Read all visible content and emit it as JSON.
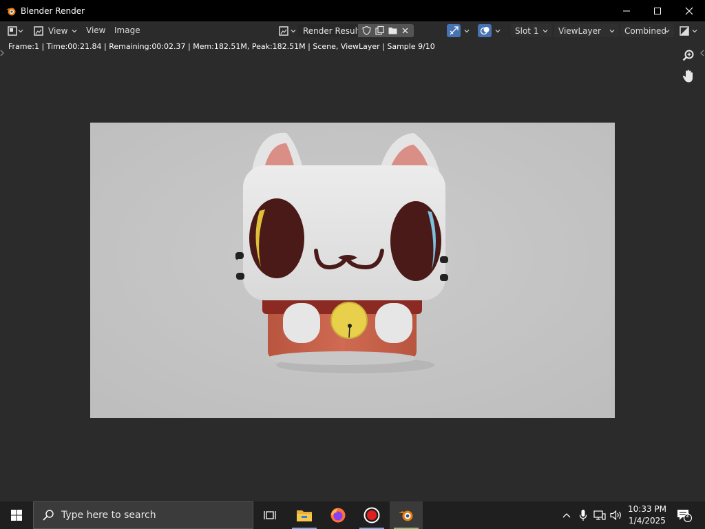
{
  "window": {
    "title": "Blender Render"
  },
  "header": {
    "menus": [
      "View",
      "View",
      "Image"
    ],
    "render_result": "Render Result",
    "slot": "Slot 1",
    "view_layer": "ViewLayer",
    "pass": "Combined"
  },
  "status": {
    "text": "Frame:1 | Time:00:21.84 | Remaining:00:02.37 | Mem:182.51M, Peak:182.51M | Scene, ViewLayer | Sample 9/10"
  },
  "render": {
    "background": "#c6c6c6"
  },
  "taskbar": {
    "search_placeholder": "Type here to search",
    "time": "10:33 PM",
    "date": "1/4/2025",
    "notification_count": "2"
  },
  "colors": {
    "accent": "#4772b3",
    "title_bar": "#000000",
    "editor_bg": "#2b2b2b"
  },
  "icons": [
    "blender-icon",
    "minimize-icon",
    "maximize-icon",
    "close-icon",
    "editor-type-icon",
    "image-icon",
    "shield-icon",
    "copy-icon",
    "folder-icon",
    "x-icon",
    "overlay-icon",
    "gizmo-icon",
    "display-channels-icon",
    "zoom-icon",
    "hand-icon",
    "windows-start-icon",
    "search-icon",
    "task-view-icon",
    "file-explorer-icon",
    "firefox-icon",
    "record-icon",
    "chevron-up-icon",
    "microphone-icon",
    "network-icon",
    "volume-icon",
    "notification-icon"
  ]
}
